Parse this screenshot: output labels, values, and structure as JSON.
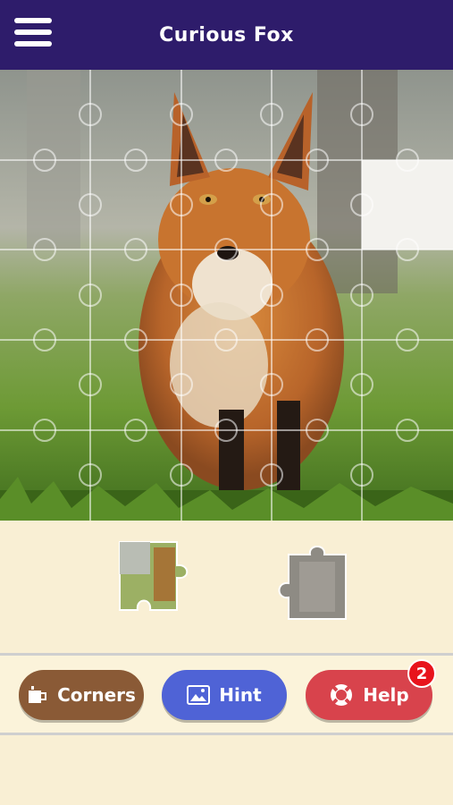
{
  "header": {
    "title": "Curious Fox",
    "menu_icon": "hamburger-menu-icon"
  },
  "puzzle": {
    "rows": 5,
    "cols": 5,
    "empty_slots": [
      [
        1,
        4
      ]
    ],
    "loose_pieces": 2
  },
  "buttons": {
    "corners": {
      "label": "Corners",
      "icon": "mug-icon"
    },
    "hint": {
      "label": "Hint",
      "icon": "image-icon"
    },
    "help": {
      "label": "Help",
      "icon": "lifebuoy-icon",
      "badge": "2"
    }
  },
  "colors": {
    "header": "#2e1c6b",
    "corners": "#8a5a36",
    "hint": "#4f63d6",
    "help": "#d8434c",
    "badge": "#e8141c",
    "background": "#f9efd4"
  }
}
